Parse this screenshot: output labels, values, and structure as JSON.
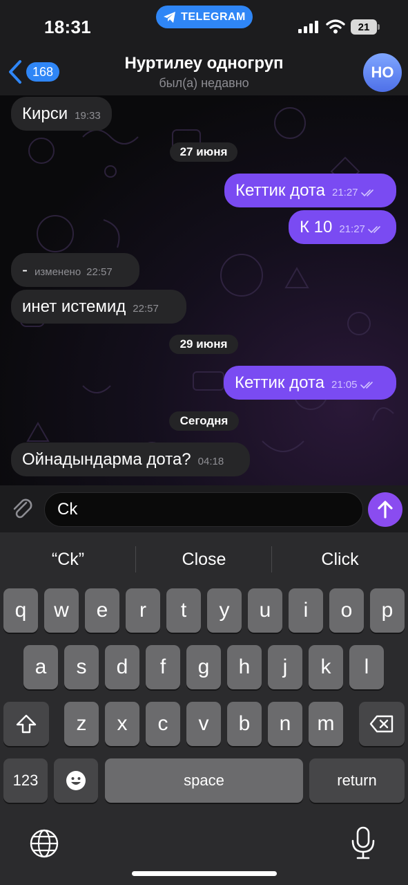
{
  "status_bar": {
    "time": "18:31",
    "app_pill": "TELEGRAM",
    "battery": "21"
  },
  "header": {
    "back_badge": "168",
    "title": "Нуртилеу одногруп",
    "subtitle": "был(а) недавно",
    "avatar_initials": "НО"
  },
  "messages": [
    {
      "dir": "in",
      "text": "Кирси",
      "time": "19:33"
    },
    {
      "date": "27 июня"
    },
    {
      "dir": "out",
      "text": "Кеттик дота",
      "time": "21:27",
      "read": true
    },
    {
      "dir": "out",
      "text": "К 10",
      "time": "21:27",
      "read": true
    },
    {
      "dir": "in",
      "text": "-",
      "edited": "изменено",
      "time": "22:57"
    },
    {
      "dir": "in",
      "text": "инет истемид",
      "time": "22:57"
    },
    {
      "date": "29 июня"
    },
    {
      "dir": "out",
      "text": "Кеттик дота",
      "time": "21:05",
      "read": true
    },
    {
      "date": "Сегодня"
    },
    {
      "dir": "in",
      "text": "Ойнадындарма дота?",
      "time": "04:18"
    }
  ],
  "composer": {
    "value": "Ck"
  },
  "keyboard": {
    "suggestions": [
      "“Ck”",
      "Close",
      "Click"
    ],
    "row1": [
      "q",
      "w",
      "e",
      "r",
      "t",
      "y",
      "u",
      "i",
      "o",
      "p"
    ],
    "row2": [
      "a",
      "s",
      "d",
      "f",
      "g",
      "h",
      "j",
      "k",
      "l"
    ],
    "row3": [
      "z",
      "x",
      "c",
      "v",
      "b",
      "n",
      "m"
    ],
    "numbers_key": "123",
    "space_key": "space",
    "return_key": "return"
  },
  "colors": {
    "accent": "#2f86f6",
    "outgoing_bubble": "#7a4bf2",
    "incoming_bubble": "#262628",
    "send_button": "#8a4cf0"
  },
  "icons": {
    "back": "chevron-left-icon",
    "read": "double-check-icon",
    "attach": "paperclip-icon",
    "emoji": "smiley-icon",
    "send": "arrow-up-icon",
    "shift": "shift-icon",
    "delete": "backspace-icon",
    "globe": "globe-icon",
    "mic": "microphone-icon"
  }
}
